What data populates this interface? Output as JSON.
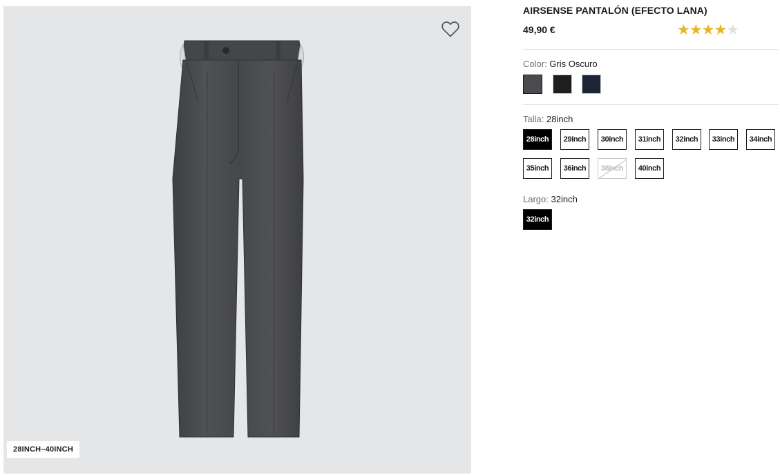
{
  "product": {
    "title": "AIRSENSE PANTALÓN (EFECTO LANA)",
    "price": "49,90 €",
    "rating": 4,
    "rating_max": 5,
    "image_badge": "28INCH–40INCH",
    "wishlist_icon": "heart-outline-icon"
  },
  "color": {
    "label": "Color:",
    "selected": "Gris Oscuro",
    "swatches": [
      {
        "name": "gris-oscuro",
        "hex": "#4a4b4e",
        "selected": true
      },
      {
        "name": "negro",
        "hex": "#1e1e1e",
        "selected": false
      },
      {
        "name": "azul-marino",
        "hex": "#1c2536",
        "selected": false
      }
    ]
  },
  "talla": {
    "label": "Talla:",
    "selected": "28inch",
    "sizes": [
      {
        "label": "28inch",
        "state": "selected"
      },
      {
        "label": "29inch",
        "state": "available"
      },
      {
        "label": "30inch",
        "state": "available"
      },
      {
        "label": "31inch",
        "state": "available"
      },
      {
        "label": "32inch",
        "state": "available"
      },
      {
        "label": "33inch",
        "state": "available"
      },
      {
        "label": "34inch",
        "state": "available"
      },
      {
        "label": "35inch",
        "state": "available"
      },
      {
        "label": "36inch",
        "state": "available"
      },
      {
        "label": "38inch",
        "state": "unavailable"
      },
      {
        "label": "40inch",
        "state": "available"
      }
    ]
  },
  "largo": {
    "label": "Largo:",
    "selected": "32inch",
    "sizes": [
      {
        "label": "32inch",
        "state": "selected"
      }
    ]
  },
  "colors": {
    "star_filled": "#e6b722",
    "star_empty": "#e0e0e0",
    "image_background": "#e5e6e8",
    "fabric": "#4a4b4e"
  }
}
